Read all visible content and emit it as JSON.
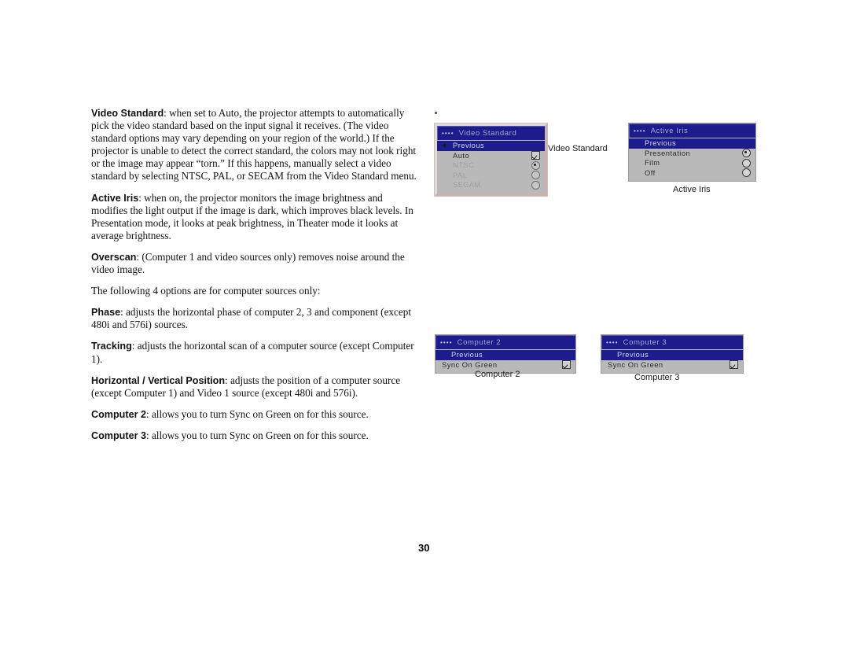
{
  "page": {
    "number": "30"
  },
  "body_text": {
    "paragraphs": [
      {
        "lead": "Video Standard",
        "text": ": when set to Auto, the projector attempts to automatically pick the video standard based on the input signal it receives. (The video standard options may vary depending on your region of the world.) If the projector is unable to detect the correct standard, the colors may not look right or the image may appear “torn.” If this happens, manually select a video standard by selecting NTSC, PAL, or SECAM from the Video Standard menu."
      },
      {
        "lead": "Active Iris",
        "text": ": when on, the projector monitors the image brightness and modifies the light output if the image is dark, which improves black levels. In Presentation mode, it looks at peak brightness, in Theater mode it looks at average brightness."
      },
      {
        "lead": "Overscan",
        "text": ": (Computer 1 and video sources only) removes noise around the video image."
      },
      {
        "lead": "",
        "text": "The following 4 options are for computer sources only:"
      },
      {
        "lead": "Phase",
        "text": ": adjusts the horizontal phase of computer 2, 3 and component (except 480i and 576i) sources."
      },
      {
        "lead": "Tracking",
        "text": ": adjusts the horizontal scan of a computer source (except Computer 1)."
      },
      {
        "lead": "Horizontal / Vertical Position",
        "text": ": adjusts the position of a computer source (except Computer 1) and Video 1 source (except 480i and 576i)."
      },
      {
        "lead": "Computer 2",
        "text": ": allows you to turn Sync on Green on for this source."
      },
      {
        "lead": "Computer 3",
        "text": ": allows you to turn Sync on Green on for this source."
      }
    ]
  },
  "menus": {
    "video_standard": {
      "title": "Video Standard",
      "title_dots": "••••",
      "caption": "Video Standard",
      "rows": [
        {
          "label": "Previous",
          "state": "selected",
          "control": "none"
        },
        {
          "label": "Auto",
          "state": "normal",
          "control": "checkbox-checked"
        },
        {
          "label": "NTSC",
          "state": "disabled",
          "control": "radio-on"
        },
        {
          "label": "PAL",
          "state": "disabled",
          "control": "radio-off"
        },
        {
          "label": "SECAM",
          "state": "disabled",
          "control": "radio-off"
        }
      ]
    },
    "active_iris": {
      "title": "Active Iris",
      "title_dots": "••••",
      "caption": "Active Iris",
      "rows": [
        {
          "label": "Previous",
          "state": "selected",
          "control": "none"
        },
        {
          "label": "Presentation",
          "state": "normal",
          "control": "radio-on"
        },
        {
          "label": "Film",
          "state": "normal",
          "control": "radio-off"
        },
        {
          "label": "Off",
          "state": "normal",
          "control": "radio-off"
        }
      ]
    },
    "computer_2": {
      "title": "Computer 2",
      "title_dots": "••••",
      "caption": "Computer 2",
      "rows": [
        {
          "label": "Previous",
          "state": "selected",
          "control": "none"
        },
        {
          "label": "Sync On Green",
          "state": "normal",
          "control": "checkbox-checked"
        }
      ]
    },
    "computer_3": {
      "title": "Computer 3",
      "title_dots": "••••",
      "caption": "Computer 3",
      "rows": [
        {
          "label": "Previous",
          "state": "selected",
          "control": "none"
        },
        {
          "label": "Sync On Green",
          "state": "normal",
          "control": "checkbox-checked"
        }
      ]
    }
  },
  "colors": {
    "menu_header_blue": "#1c1c8c",
    "menu_body_gray": "#b9b9b9",
    "menu_highlight_blue": "#1c1c8c",
    "menu_disabled_text": "#9e9e9e",
    "page_background": "#ffffff"
  }
}
